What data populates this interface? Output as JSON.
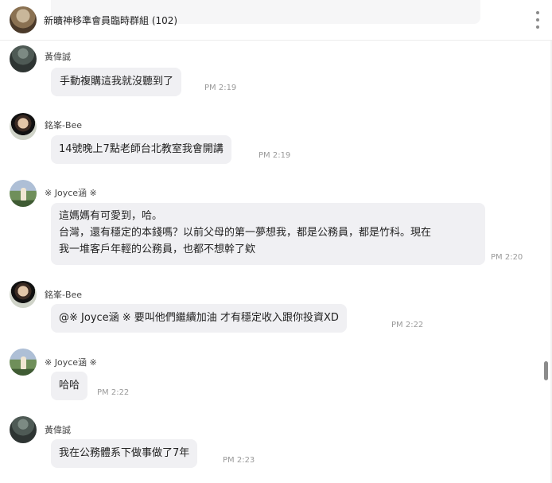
{
  "header": {
    "group_title": "新曠神移準會員臨時群組 (102)",
    "menu_icon": "more-vertical-icon"
  },
  "messages": [
    {
      "sender": "黃偉誠",
      "lines": [
        "手動複購這我就沒聽到了"
      ],
      "time": "PM 2:19"
    },
    {
      "sender": "銘峯-Bee",
      "lines": [
        "14號晚上7點老師台北教室我會開講"
      ],
      "time": "PM 2:19"
    },
    {
      "sender": "※ Joyce涵 ※",
      "lines": [
        "這媽媽有可愛到，哈。",
        "台灣，還有穩定的本錢嗎？以前父母的第一夢想我，都是公務員，都是竹科。現在",
        "我一堆客戶年輕的公務員，也都不想幹了欸"
      ],
      "time": "PM 2:20"
    },
    {
      "sender": "銘峯-Bee",
      "lines": [
        "@※ Joyce涵 ※ 要叫他們繼續加油 才有穩定收入跟你投資XD"
      ],
      "time": "PM 2:22"
    },
    {
      "sender": "※ Joyce涵 ※",
      "lines": [
        "哈哈"
      ],
      "time": "PM 2:22"
    },
    {
      "sender": "黃偉誠",
      "lines": [
        "我在公務體系下做事做了7年"
      ],
      "time": "PM 2:23"
    }
  ],
  "colors": {
    "bubble": "#f0f0f3",
    "time": "#9a9a9a",
    "header_border": "#ececec"
  }
}
